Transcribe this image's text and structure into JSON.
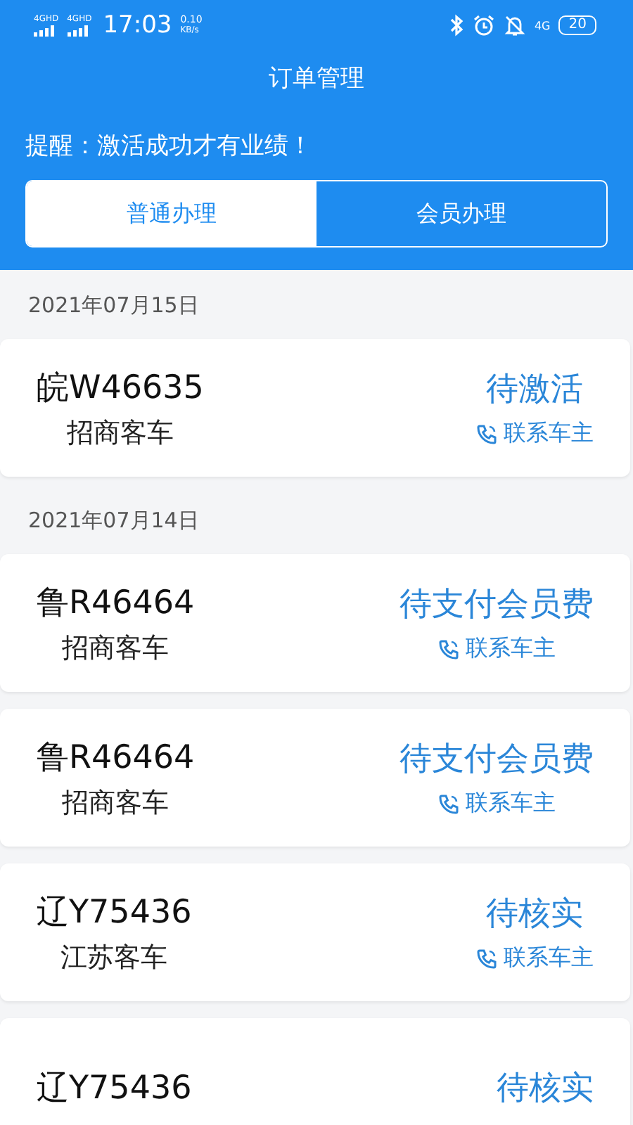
{
  "status_bar": {
    "sim_labels": [
      "4GHD",
      "4GHD"
    ],
    "time": "17:03",
    "speed": "0.10",
    "speed_unit": "KB/s",
    "network": "4G",
    "battery": "20"
  },
  "title": "订单管理",
  "notice": "提醒：激活成功才有业绩！",
  "tabs": [
    {
      "label": "普通办理",
      "selected": true
    },
    {
      "label": "会员办理",
      "selected": false
    }
  ],
  "groups": [
    {
      "date": "2021年07月15日",
      "orders": [
        {
          "plate": "皖W46635",
          "type": "招商客车",
          "status": "待激活",
          "contact": "联系车主"
        }
      ]
    },
    {
      "date": "2021年07月14日",
      "orders": [
        {
          "plate": "鲁R46464",
          "type": "招商客车",
          "status": "待支付会员费",
          "contact": "联系车主"
        },
        {
          "plate": "鲁R46464",
          "type": "招商客车",
          "status": "待支付会员费",
          "contact": "联系车主"
        },
        {
          "plate": "辽Y75436",
          "type": "江苏客车",
          "status": "待核实",
          "contact": "联系车主"
        },
        {
          "plate": "辽Y75436",
          "status": "待核实"
        }
      ]
    }
  ]
}
